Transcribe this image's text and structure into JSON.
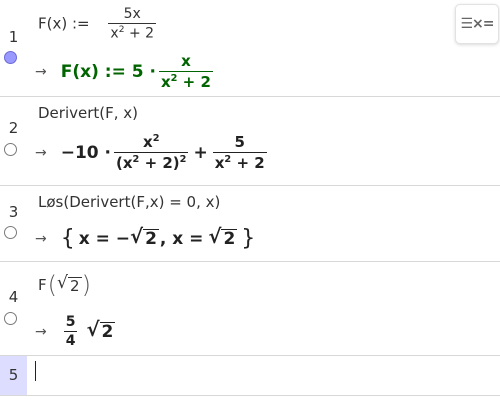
{
  "rows": [
    {
      "num": "1",
      "input": {
        "lhs": "F(x) :=",
        "num": "5x",
        "den_base": "x",
        "den_exp": "2",
        "den_rest": "+ 2"
      },
      "output": {
        "arrow": "→",
        "lhs": "F(x) := 5 ·",
        "num": "x",
        "den_base": "x",
        "den_exp": "2",
        "den_rest": "+ 2"
      },
      "color": "#006400"
    },
    {
      "num": "2",
      "input": {
        "text": "Derivert(F, x)"
      },
      "output": {
        "arrow": "→",
        "lead": "−10 ·",
        "num1_base": "x",
        "num1_exp": "2",
        "den1_base": "(x",
        "den1_exp": "2",
        "den1_rest": "+ 2)",
        "den1_exp2": "2",
        "plus": "+",
        "num2": "5",
        "den2_base": "x",
        "den2_exp": "2",
        "den2_rest": "+ 2"
      }
    },
    {
      "num": "3",
      "input": {
        "text": "Løs(Derivert(F,x) = 0, x)"
      },
      "output": {
        "arrow": "→",
        "open": "{",
        "part1": "x = −",
        "r1": "2",
        "comma": ", x =",
        "r2": "2",
        "close": "}"
      }
    },
    {
      "num": "4",
      "input": {
        "fn": "F",
        "r": "2"
      },
      "output": {
        "arrow": "→",
        "num": "5",
        "den": "4",
        "r": "2"
      }
    },
    {
      "num": "5"
    }
  ],
  "toolbar": {
    "icon": "algebra-menu-icon",
    "glyph": "☰×="
  }
}
